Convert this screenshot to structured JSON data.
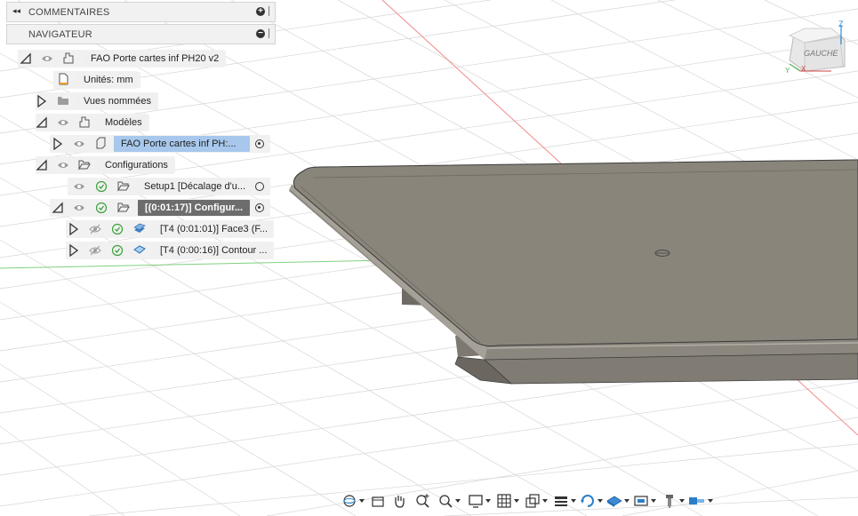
{
  "panels": {
    "comments": {
      "label": "COMMENTAIRES"
    },
    "navigator": {
      "label": "NAVIGATEUR"
    }
  },
  "browser": {
    "root": {
      "label": "FAO Porte cartes inf PH20 v2"
    },
    "units": {
      "label": "Unités: mm"
    },
    "named_views": {
      "label": "Vues nommées"
    },
    "models": {
      "label": "Modèles"
    },
    "model_item": {
      "label": "FAO Porte cartes inf PH:..."
    },
    "setups": {
      "label": "Configurations"
    },
    "setup1": {
      "label": "Setup1 [Décalage d'u..."
    },
    "setup2": {
      "label": "[(0:01:17)] Configur..."
    },
    "op1": {
      "label": "[T4 (0:01:01)] Face3 (F..."
    },
    "op2": {
      "label": "[T4 (0:00:16)] Contour ..."
    }
  },
  "viewcube": {
    "face_label": "GAUCHE",
    "axis_z": "Z",
    "axis_x": "X",
    "axis_y": "Y"
  },
  "colors": {
    "accent_selected": "#a7c8ec",
    "check_green": "#3aa23a",
    "model_gray": "#8a857b"
  },
  "toolbar": {
    "icons": [
      "orbit-icon",
      "view-icon",
      "pan-icon",
      "zoom-icon",
      "fit-icon",
      "display-settings-icon",
      "grid-icon",
      "viewports-icon",
      "section-icon",
      "simulation-icon",
      "stock-icon",
      "tool-display-icon",
      "toolpath-display-icon",
      "machine-icon"
    ]
  }
}
